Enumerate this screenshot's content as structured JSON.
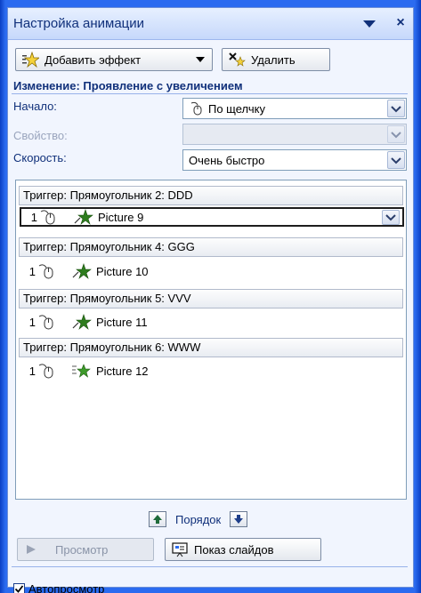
{
  "pane": {
    "title": "Настройка анимации",
    "close_glyph": "×"
  },
  "toolbar": {
    "add_effect_label": "Добавить эффект",
    "delete_label": "Удалить"
  },
  "change": {
    "label": "Изменение: Проявление с увеличением"
  },
  "fields": {
    "start_label": "Начало:",
    "start_value": "По щелчку",
    "property_label": "Свойство:",
    "property_value": "",
    "speed_label": "Скорость:",
    "speed_value": "Очень быстро"
  },
  "animation_list": [
    {
      "trigger": "Триггер: Прямоугольник 2: DDD",
      "num": "1",
      "name": "Picture 9",
      "selected": true,
      "icon": "star-green-icon"
    },
    {
      "trigger": "Триггер: Прямоугольник 4: GGG",
      "num": "1",
      "name": "Picture 10",
      "selected": false,
      "icon": "star-green-icon"
    },
    {
      "trigger": "Триггер: Прямоугольник 5: VVV",
      "num": "1",
      "name": "Picture 11",
      "selected": false,
      "icon": "star-green-icon"
    },
    {
      "trigger": "Триггер: Прямоугольник 6: WWW",
      "num": "1",
      "name": "Picture 12",
      "selected": false,
      "icon": "star-sparkle-icon"
    }
  ],
  "order": {
    "label": "Порядок"
  },
  "preview": {
    "preview_label": "Просмотр",
    "slideshow_label": "Показ слайдов"
  },
  "autopreview": {
    "label": "Автопросмотр",
    "checked": true
  },
  "colors": {
    "frame_blue": "#2b6bf0",
    "heading_blue": "#10307a",
    "star_green": "#2e7d1e"
  }
}
